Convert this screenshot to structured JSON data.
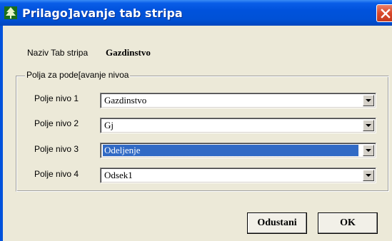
{
  "window": {
    "title": "Prilago]avanje tab stripa"
  },
  "naziv": {
    "label": "Naziv Tab stripa",
    "value": "Gazdinstvo"
  },
  "group": {
    "legend": "Polja za pode[avanje nivoa",
    "rows": [
      {
        "label": "Polje nivo 1",
        "value": "Gazdinstvo",
        "selected": false
      },
      {
        "label": "Polje nivo 2",
        "value": "Gj",
        "selected": false
      },
      {
        "label": "Polje nivo 3",
        "value": "Odeljenje",
        "selected": true
      },
      {
        "label": "Polje nivo 4",
        "value": "Odsek1",
        "selected": false
      }
    ]
  },
  "buttons": {
    "cancel_label": "Odustani",
    "ok_label": "OK"
  },
  "colors": {
    "titlebar": "#0052dc",
    "face": "#ece9d8",
    "selection": "#316ac5",
    "close": "#d9482a"
  },
  "icons": {
    "title": "tree-icon",
    "close": "close-icon",
    "dropdown": "chevron-down-icon"
  }
}
